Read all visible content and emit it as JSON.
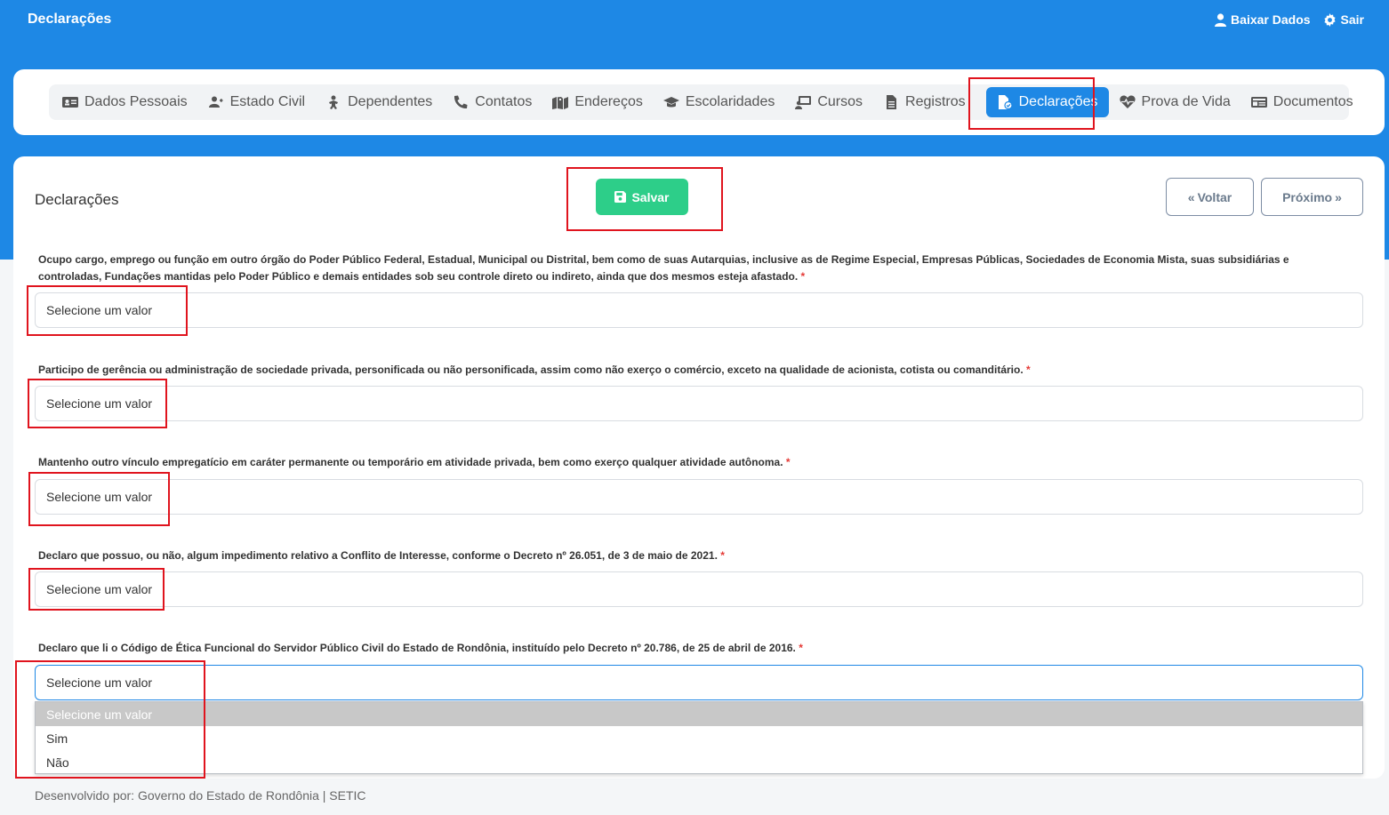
{
  "header": {
    "title": "Declarações",
    "actions": {
      "download": "Baixar Dados",
      "logout": "Sair"
    }
  },
  "nav": {
    "items": [
      {
        "label": "Dados Pessoais",
        "icon": "id-card-icon"
      },
      {
        "label": "Estado Civil",
        "icon": "user-couple-icon"
      },
      {
        "label": "Dependentes",
        "icon": "child-icon"
      },
      {
        "label": "Contatos",
        "icon": "phone-icon"
      },
      {
        "label": "Endereços",
        "icon": "map-marker-icon"
      },
      {
        "label": "Escolaridades",
        "icon": "graduation-cap-icon"
      },
      {
        "label": "Cursos",
        "icon": "chalkboard-icon"
      },
      {
        "label": "Registros",
        "icon": "file-icon"
      },
      {
        "label": "Declarações",
        "icon": "file-check-icon",
        "active": true
      },
      {
        "label": "Prova de Vida",
        "icon": "heartbeat-icon"
      },
      {
        "label": "Documentos",
        "icon": "document-card-icon"
      }
    ]
  },
  "form": {
    "title": "Declarações",
    "save_label": "Salvar",
    "back_label": "Voltar",
    "next_label": "Próximo",
    "select_placeholder": "Selecione um valor",
    "required_mark": "*",
    "questions": [
      "Ocupo cargo, emprego ou função em outro órgão do Poder Público Federal, Estadual, Municipal ou Distrital, bem como de suas Autarquias, inclusive as de Regime Especial, Empresas Públicas, Sociedades de Economia Mista, suas subsidiárias e controladas, Fundações mantidas pelo Poder Público e demais entidades sob seu controle direto ou indireto, ainda que dos mesmos esteja afastado.",
      "Participo de gerência ou administração de sociedade privada, personificada ou não personificada, assim como não exerço o comércio, exceto na qualidade de acionista, cotista ou comanditário.",
      "Mantenho outro vínculo empregatício em caráter permanente ou temporário em atividade privada, bem como exerço qualquer atividade autônoma.",
      "Declaro que possuo, ou não, algum impedimento relativo a Conflito de Interesse, conforme o Decreto nº 26.051, de 3 de maio de 2021.",
      "Declaro que li o Código de Ética Funcional do Servidor Público Civil do Estado de Rondônia, instituído pelo Decreto nº 20.786, de 25 de abril de 2016."
    ],
    "dropdown_options": [
      "Selecione um valor",
      "Sim",
      "Não"
    ]
  },
  "footer": {
    "text": "Desenvolvido por: Governo do Estado de Rondônia | SETIC"
  },
  "colors": {
    "primary": "#1e88e5",
    "success": "#2dce89",
    "highlight": "#e0141e"
  }
}
